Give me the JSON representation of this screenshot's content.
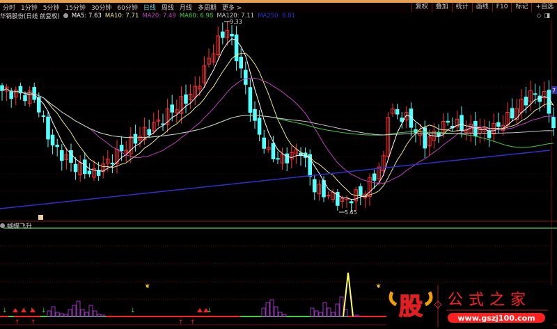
{
  "toolbar": {
    "periods": [
      "分时",
      "1分钟",
      "5分钟",
      "15分钟",
      "30分钟",
      "60分钟",
      "日线",
      "周线",
      "月线",
      "多周期",
      "更多 >"
    ],
    "active_period": "日线",
    "right_buttons": [
      "复权",
      "叠加",
      "统计",
      "画线",
      "F10",
      "标记",
      "+自选"
    ]
  },
  "legend": {
    "stock": "华锦股份(日线 前复权)",
    "ma": [
      {
        "label": "MA5: 7.63",
        "color": "#ffffff"
      },
      {
        "label": "MA10: 7.71",
        "color": "#f0e68c"
      },
      {
        "label": "MA20: 7.49",
        "color": "#c040c0"
      },
      {
        "label": "MA60: 6.98",
        "color": "#40d040"
      },
      {
        "label": "MA120: 7.11",
        "color": "#c8c8c8"
      },
      {
        "label": "MA250: 6.81",
        "color": "#3030d0"
      }
    ]
  },
  "price_labels": {
    "high": "9.33",
    "low": "5.65",
    "right_axis": "7"
  },
  "indicator": {
    "title": "蝴蝶飞升"
  },
  "watermark": {
    "logo_char": "股",
    "name": "公式之家",
    "url": "www.gszj100.com"
  },
  "colors": {
    "up": "#ff3030",
    "down": "#54ffff",
    "bg": "#000000",
    "grid": "#6a1010"
  },
  "price_keypoints": {
    "bars": [
      0,
      7,
      11,
      16,
      20,
      27,
      35,
      42,
      46,
      49,
      52,
      55,
      58,
      61,
      65,
      68,
      74,
      79,
      83,
      84,
      88,
      92,
      97,
      101,
      106,
      110,
      115,
      118,
      120
    ],
    "close": [
      7.99,
      7.86,
      6.89,
      6.48,
      6.34,
      6.89,
      7.44,
      7.99,
      8.82,
      9.23,
      8.41,
      7.31,
      6.75,
      6.62,
      6.82,
      6.06,
      5.79,
      6.0,
      6.62,
      7.58,
      7.44,
      6.96,
      7.37,
      7.24,
      7.17,
      7.44,
      7.92,
      7.86,
      7.31
    ]
  }
}
